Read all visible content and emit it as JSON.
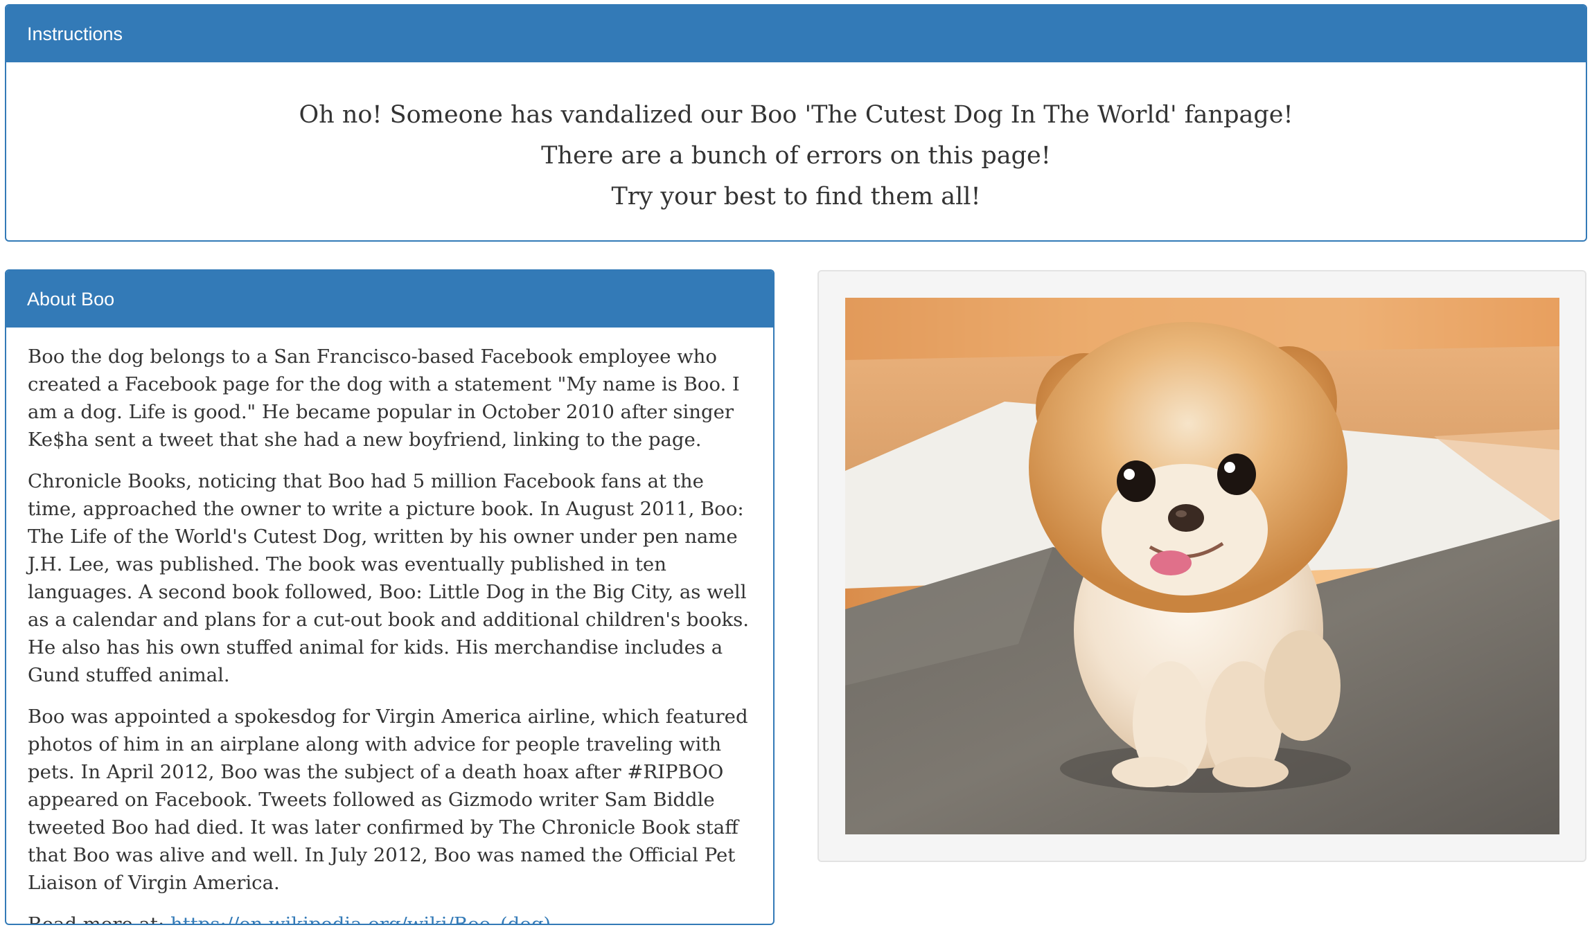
{
  "instructions": {
    "heading": "Instructions",
    "lines": [
      "Oh no! Someone has vandalized our Boo 'The Cutest Dog In The World' fanpage!",
      "There are a bunch of errors on this page!",
      "Try your best to find them all!"
    ]
  },
  "about": {
    "heading": "About Boo",
    "paragraphs": [
      "Boo the dog belongs to a San Francisco-based Facebook employee who created a Facebook page for the dog with a statement \"My name is Boo. I am a dog. Life is good.\" He became popular in October 2010 after singer Ke$ha sent a tweet that she had a new boyfriend, linking to the page.",
      "Chronicle Books, noticing that Boo had 5 million Facebook fans at the time, approached the owner to write a picture book. In August 2011, Boo: The Life of the World's Cutest Dog, written by his owner under pen name J.H. Lee, was published. The book was eventually published in ten languages. A second book followed, Boo: Little Dog in the Big City, as well as a calendar and plans for a cut-out book and additional children's books. He also has his own stuffed animal for kids. His merchandise includes a Gund stuffed animal.",
      "Boo was appointed a spokesdog for Virgin America airline, which featured photos of him in an airplane along with advice for people traveling with pets. In April 2012, Boo was the subject of a death hoax after #RIPBOO appeared on Facebook. Tweets followed as Gizmodo writer Sam Biddle tweeted Boo had died. It was later confirmed by The Chronicle Book staff that Boo was alive and well. In July 2012, Boo was named the Official Pet Liaison of Virgin America."
    ],
    "read_more_label": "Read more at:",
    "read_more_link": "https://en.wikipedia.org/wiki/Boo_(dog)"
  },
  "colors": {
    "primary": "#337ab7",
    "well_background": "#f5f5f5",
    "text": "#333333"
  },
  "photo": {
    "subject": "pomeranian-dog-photo"
  }
}
